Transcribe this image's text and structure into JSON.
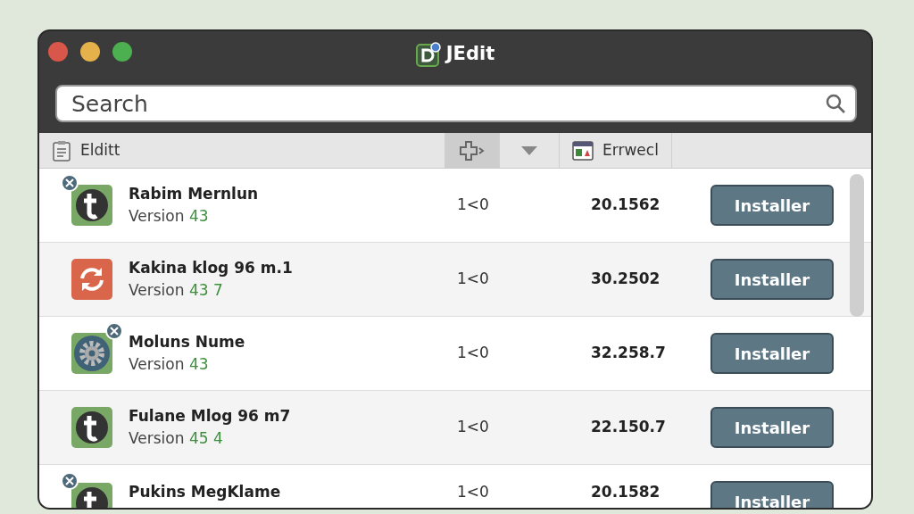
{
  "window": {
    "title": "JEdit"
  },
  "search": {
    "placeholder": "Search"
  },
  "toolbar": [
    {
      "kind": "label",
      "label": "Elditt",
      "selected": false
    },
    {
      "kind": "icon",
      "selected": true
    },
    {
      "kind": "dropdown",
      "selected": false
    },
    {
      "kind": "label",
      "label": "Errwecl",
      "selected": false
    }
  ],
  "rows": [
    {
      "name": "Rabim Mernlun",
      "version_label": "Version",
      "version": "43",
      "column_3": "1<0",
      "column_4": "20.1562",
      "button": "Installer"
    },
    {
      "name": "Kakina klog 96 m.1",
      "version_label": "Version",
      "version": "43 7",
      "column_3": "1<0",
      "column_4": "30.2502",
      "button": "Installer"
    },
    {
      "name": "Moluns Nume",
      "version_label": "Version",
      "version": "43",
      "column_3": "1<0",
      "column_4": "32.258.7",
      "button": "Installer"
    },
    {
      "name": "Fulane Mlog 96 m7",
      "version_label": "Version",
      "version": "45 4",
      "column_3": "1<0",
      "column_4": "22.150.7",
      "button": "Installer"
    },
    {
      "name": "Pukins MegKlame",
      "column_3": "1<0",
      "column_4": "20.1582",
      "button": "Installer"
    }
  ]
}
